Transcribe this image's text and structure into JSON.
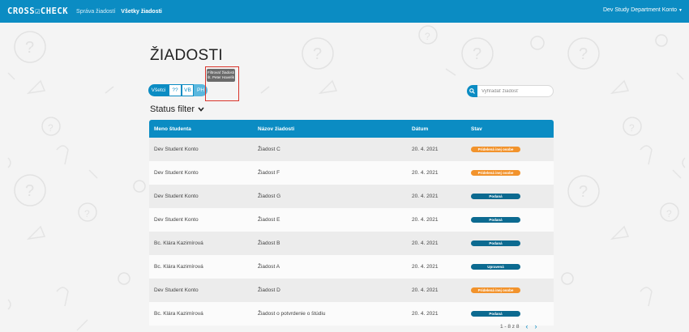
{
  "navbar": {
    "brand": "CROSS☑CHECK",
    "links": [
      "Správa žiadostí",
      "Všetky žiadosti"
    ],
    "account": "Dev Study Department Konto"
  },
  "page": {
    "title": "ŽIADOSTI"
  },
  "filters": {
    "buttons": [
      "Všetci",
      "??",
      "VB",
      "PH"
    ],
    "tooltip": "Filtrovať žiadosti št. Peter Havelík"
  },
  "search": {
    "placeholder": "Vyhľadať žiadosť"
  },
  "status_filter": {
    "label": "Status filter"
  },
  "table": {
    "headers": [
      "Meno študenta",
      "Názov žiadosti",
      "Dátum",
      "Stav"
    ],
    "rows": [
      {
        "student": "Dev Student Konto",
        "name": "Žiadost C",
        "date": "20. 4. 2021",
        "status": "Pridelená inej osobe",
        "color": "#f2932c"
      },
      {
        "student": "Dev Student Konto",
        "name": "Žiadost F",
        "date": "20. 4. 2021",
        "status": "Pridelená inej osobe",
        "color": "#f2932c"
      },
      {
        "student": "Dev Student Konto",
        "name": "Žiadost G",
        "date": "20. 4. 2021",
        "status": "Podaná",
        "color": "#0c6a90"
      },
      {
        "student": "Dev Student Konto",
        "name": "Žiadost E",
        "date": "20. 4. 2021",
        "status": "Podaná",
        "color": "#0c6a90"
      },
      {
        "student": "Bc. Klára Kazimírová",
        "name": "Žiadost B",
        "date": "20. 4. 2021",
        "status": "Podaná",
        "color": "#0c6a90"
      },
      {
        "student": "Bc. Klára Kazimírová",
        "name": "Žiadost A",
        "date": "20. 4. 2021",
        "status": "Upravená",
        "color": "#0c6a90"
      },
      {
        "student": "Dev Student Konto",
        "name": "Žiadost D",
        "date": "20. 4. 2021",
        "status": "Pridelená inej osobe",
        "color": "#f2932c"
      },
      {
        "student": "Bc. Klára Kazimírová",
        "name": "Žiadost o potvrdenie o štúdiu",
        "date": "20. 4. 2021",
        "status": "Podaná",
        "color": "#0c6a90"
      }
    ]
  },
  "pagination": {
    "text": "1 - 8 z 8",
    "prev": "‹",
    "next": "›"
  },
  "colors": {
    "primary": "#0b8cc3",
    "orange": "#f2932c",
    "dark_blue": "#0c6a90",
    "highlight": "#d9342b"
  }
}
